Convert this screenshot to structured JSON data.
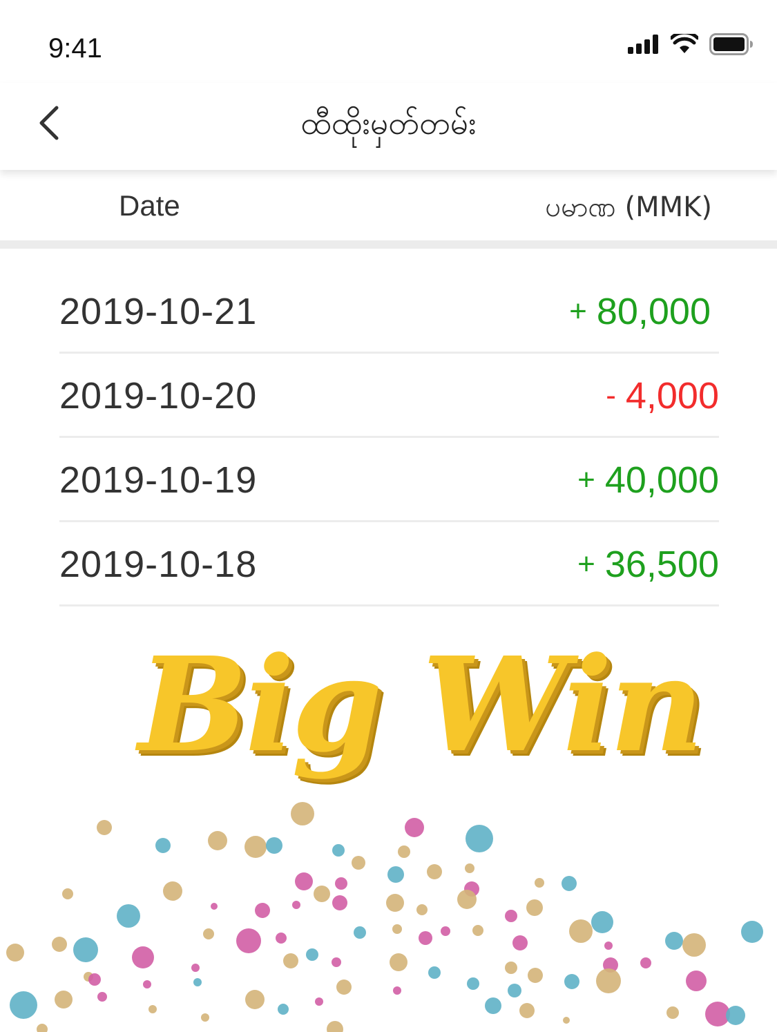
{
  "status_bar": {
    "time": "9:41",
    "icons": [
      "cellular-signal-icon",
      "wifi-icon",
      "battery-icon"
    ]
  },
  "nav": {
    "back_icon": "chevron-left-icon",
    "title": "ထီထိုးမှတ်တမ်း"
  },
  "columns": {
    "date": "Date",
    "amount": "ပမာဏ (MMK)"
  },
  "history": [
    {
      "date": "2019-10-21",
      "sign": "+",
      "value": "80,000",
      "type": "pos"
    },
    {
      "date": "2019-10-20",
      "sign": "-",
      "value": "4,000",
      "type": "neg"
    },
    {
      "date": "2019-10-19",
      "sign": "+",
      "value": "40,000",
      "type": "pos"
    },
    {
      "date": "2019-10-18",
      "sign": "+",
      "value": "36,500",
      "type": "pos"
    }
  ],
  "banner": {
    "text": "Big Win"
  },
  "colors": {
    "positive": "#1ea01e",
    "negative": "#f22c2c",
    "banner_gold": "#f7c62a",
    "confetti": [
      "#d4b479",
      "#5fb1c6",
      "#d15ea5"
    ]
  }
}
